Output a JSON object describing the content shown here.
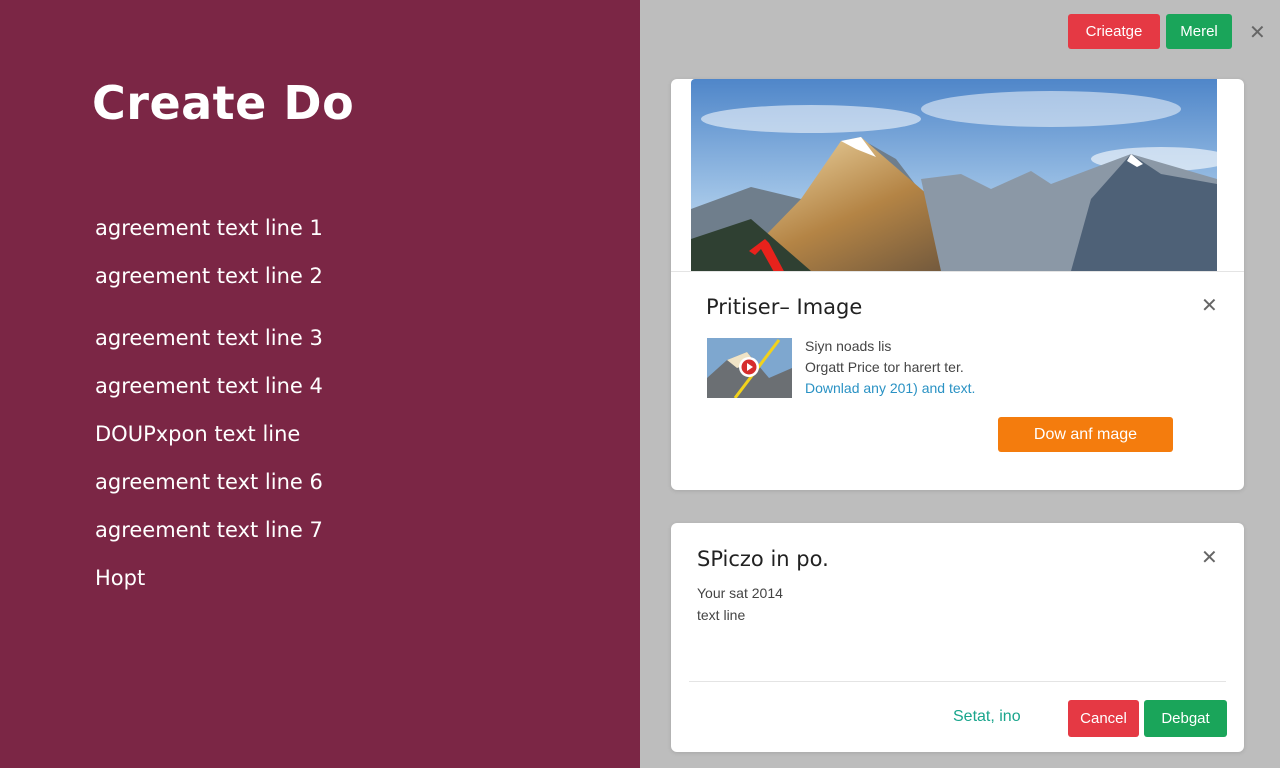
{
  "left": {
    "title": "Create Do",
    "lines": [
      "agreement text line 1",
      "agreement text line 2",
      "agreement text line 3",
      "agreement text line 4",
      "DOUPxpon text line",
      "agreement text line 6",
      "agreement text line 7",
      "Hopt"
    ]
  },
  "topbar": {
    "create_label": "Crieatge",
    "merge_label": "Merel",
    "close_glyph": "✕"
  },
  "image_card": {
    "title": "Pritiser– Image",
    "close_glyph": "✕",
    "desc_line1": "Siyn noads lis",
    "desc_line2": "Orgatt Price tor harert ter.",
    "desc_link": "Downlad any 201) and text.",
    "cta_label": "Dow anf mage"
  },
  "info_card": {
    "title": "SPiczo in po.",
    "close_glyph": "✕",
    "body_line1": "Your sat 2014",
    "body_line2": "text line",
    "link_label": "Setat, ino",
    "red_label": "Cancel",
    "green_label": "Debgat"
  },
  "colors": {
    "left_bg": "#7b2645",
    "btn_red": "#e53944",
    "btn_green": "#1aa55a",
    "cta_orange": "#f47c0d",
    "link_teal": "#19a58c",
    "link_blue": "#2a92c4"
  }
}
